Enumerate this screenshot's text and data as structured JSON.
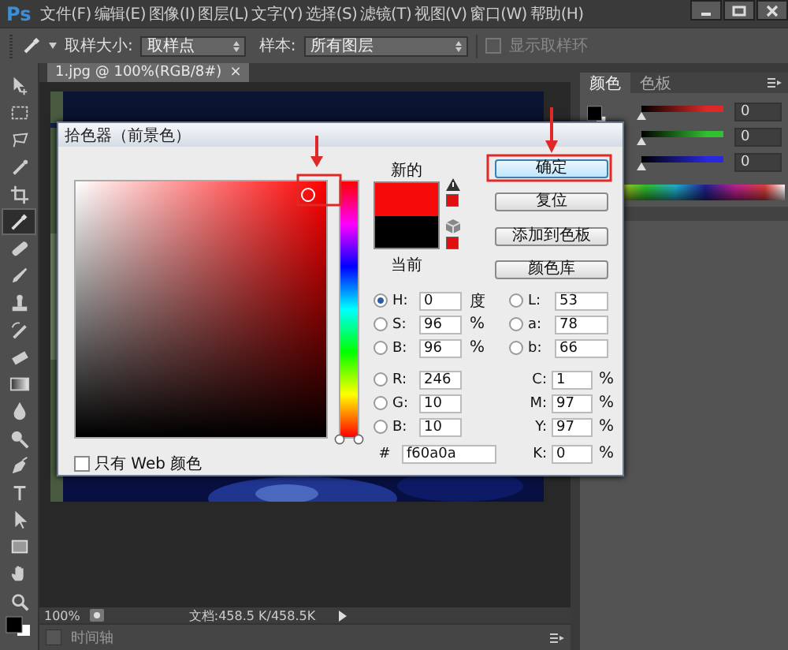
{
  "menu_bar": {
    "logo": "Ps",
    "items": [
      "文件(F)",
      "编辑(E)",
      "图像(I)",
      "图层(L)",
      "文字(Y)",
      "选择(S)",
      "滤镜(T)",
      "视图(V)",
      "窗口(W)",
      "帮助(H)"
    ]
  },
  "options_bar": {
    "sample_size_label": "取样大小:",
    "sample_size": "取样点",
    "sample_label": "样本:",
    "sample": "所有图层",
    "sample_ring": {
      "label": "显示取样环",
      "checked": false,
      "disabled": true
    }
  },
  "tools": [
    {
      "kind": "move",
      "selected": false
    },
    {
      "kind": "marquee",
      "selected": false
    },
    {
      "kind": "lasso",
      "selected": false
    },
    {
      "kind": "quick",
      "selected": false
    },
    {
      "kind": "crop",
      "selected": false
    },
    {
      "kind": "eyedropper",
      "selected": true
    },
    {
      "kind": "healing",
      "selected": false
    },
    {
      "kind": "brush",
      "selected": false
    },
    {
      "kind": "stamp",
      "selected": false
    },
    {
      "kind": "history",
      "selected": false
    },
    {
      "kind": "eraser",
      "selected": false
    },
    {
      "kind": "gradient",
      "selected": false
    },
    {
      "kind": "blur",
      "selected": false
    },
    {
      "kind": "dodge",
      "selected": false
    },
    {
      "kind": "pen",
      "selected": false
    },
    {
      "kind": "type",
      "selected": false
    },
    {
      "kind": "path",
      "selected": false
    },
    {
      "kind": "shape",
      "selected": false
    },
    {
      "kind": "hand",
      "selected": false
    },
    {
      "kind": "zoom",
      "selected": false
    }
  ],
  "document": {
    "tab": "1.jpg @ 100%(RGB/8#)",
    "close": "×",
    "zoom": "100%",
    "doc_size": "文档:458.5 K/458.5K"
  },
  "timeline": {
    "label": "时间轴"
  },
  "color_panel": {
    "tabs": [
      {
        "label": "颜色",
        "selected": true
      },
      {
        "label": "色板",
        "selected": false
      }
    ],
    "sliders": [
      {
        "color": "#e02828",
        "level": 0,
        "value": "0"
      },
      {
        "color": "#30c030",
        "level": 0,
        "value": "0"
      },
      {
        "color": "#2828e0",
        "level": 0,
        "value": "0"
      }
    ]
  },
  "color_picker": {
    "title": "拾色器（前景色）",
    "hue_slider": {
      "level": 0
    },
    "swatches": [
      {
        "label": "新的",
        "color": "#f60a0a"
      },
      {
        "label": "当前",
        "color": "#000000"
      }
    ],
    "buttons": [
      {
        "label": "确定",
        "default": true
      },
      {
        "label": "复位",
        "default": false
      },
      {
        "label": "添加到色板",
        "default": false
      },
      {
        "label": "颜色库",
        "default": false
      }
    ],
    "hsb": [
      {
        "label": "H:",
        "value": "0",
        "unit": "度",
        "selected": true
      },
      {
        "label": "S:",
        "value": "96",
        "unit": "%",
        "selected": false
      },
      {
        "label": "B:",
        "value": "96",
        "unit": "%",
        "selected": false
      }
    ],
    "rgb": [
      {
        "label": "R:",
        "value": "246",
        "selected": false
      },
      {
        "label": "G:",
        "value": "10",
        "selected": false
      },
      {
        "label": "B:",
        "value": "10",
        "selected": false
      }
    ],
    "lab": [
      {
        "label": "L:",
        "value": "53",
        "selected": false
      },
      {
        "label": "a:",
        "value": "78",
        "selected": false
      },
      {
        "label": "b:",
        "value": "66",
        "selected": false
      }
    ],
    "cmyk": [
      {
        "label": "C:",
        "value": "1",
        "unit": "%"
      },
      {
        "label": "M:",
        "value": "97",
        "unit": "%"
      },
      {
        "label": "Y:",
        "value": "97",
        "unit": "%"
      },
      {
        "label": "K:",
        "value": "0",
        "unit": "%"
      }
    ],
    "hex": {
      "label": "#",
      "value": "f60a0a"
    },
    "web_only": {
      "label": "只有 Web 颜色",
      "checked": false
    }
  }
}
